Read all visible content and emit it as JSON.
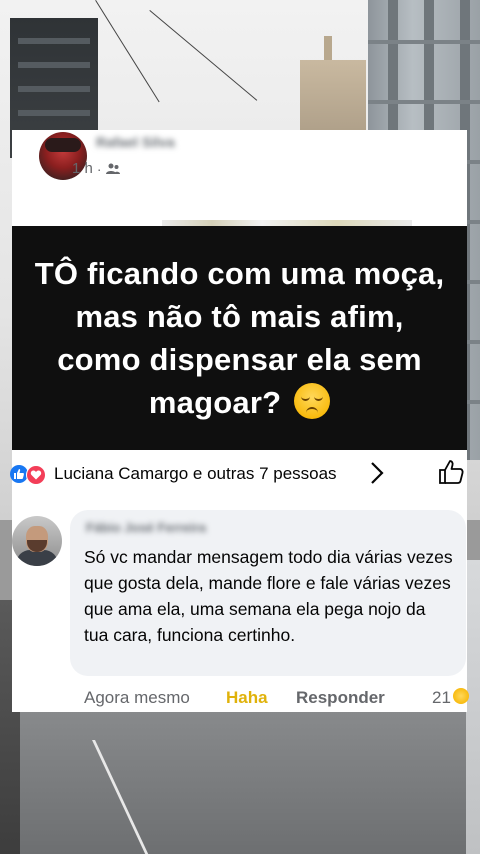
{
  "post": {
    "author": "Rafael Silva",
    "time": "1 h",
    "audience_icon": "friends-icon",
    "banner_text": "TÔ ficando com uma moça, mas não tô mais afim, como dispensar ela sem magoar?",
    "banner_emoji": "pensive-face-emoji"
  },
  "reactions": {
    "icons": [
      "like-icon",
      "love-icon"
    ],
    "summary": "Luciana Camargo e outras 7 pessoas"
  },
  "comment": {
    "author": "Fábio José Ferreira",
    "text": "Só vc mandar mensagem todo dia várias vezes que gosta dela, mande flore e fale várias vezes que ama ela, uma semana ela pega nojo da tua cara, funciona certinho.",
    "time": "Agora mesmo",
    "reaction_label": "Haha",
    "reply_label": "Responder",
    "reaction_count": "21"
  },
  "colors": {
    "banner_bg": "#0f0f0f",
    "haha": "#e0b20b",
    "like_blue": "#1877f2",
    "love_red": "#f33e58"
  }
}
